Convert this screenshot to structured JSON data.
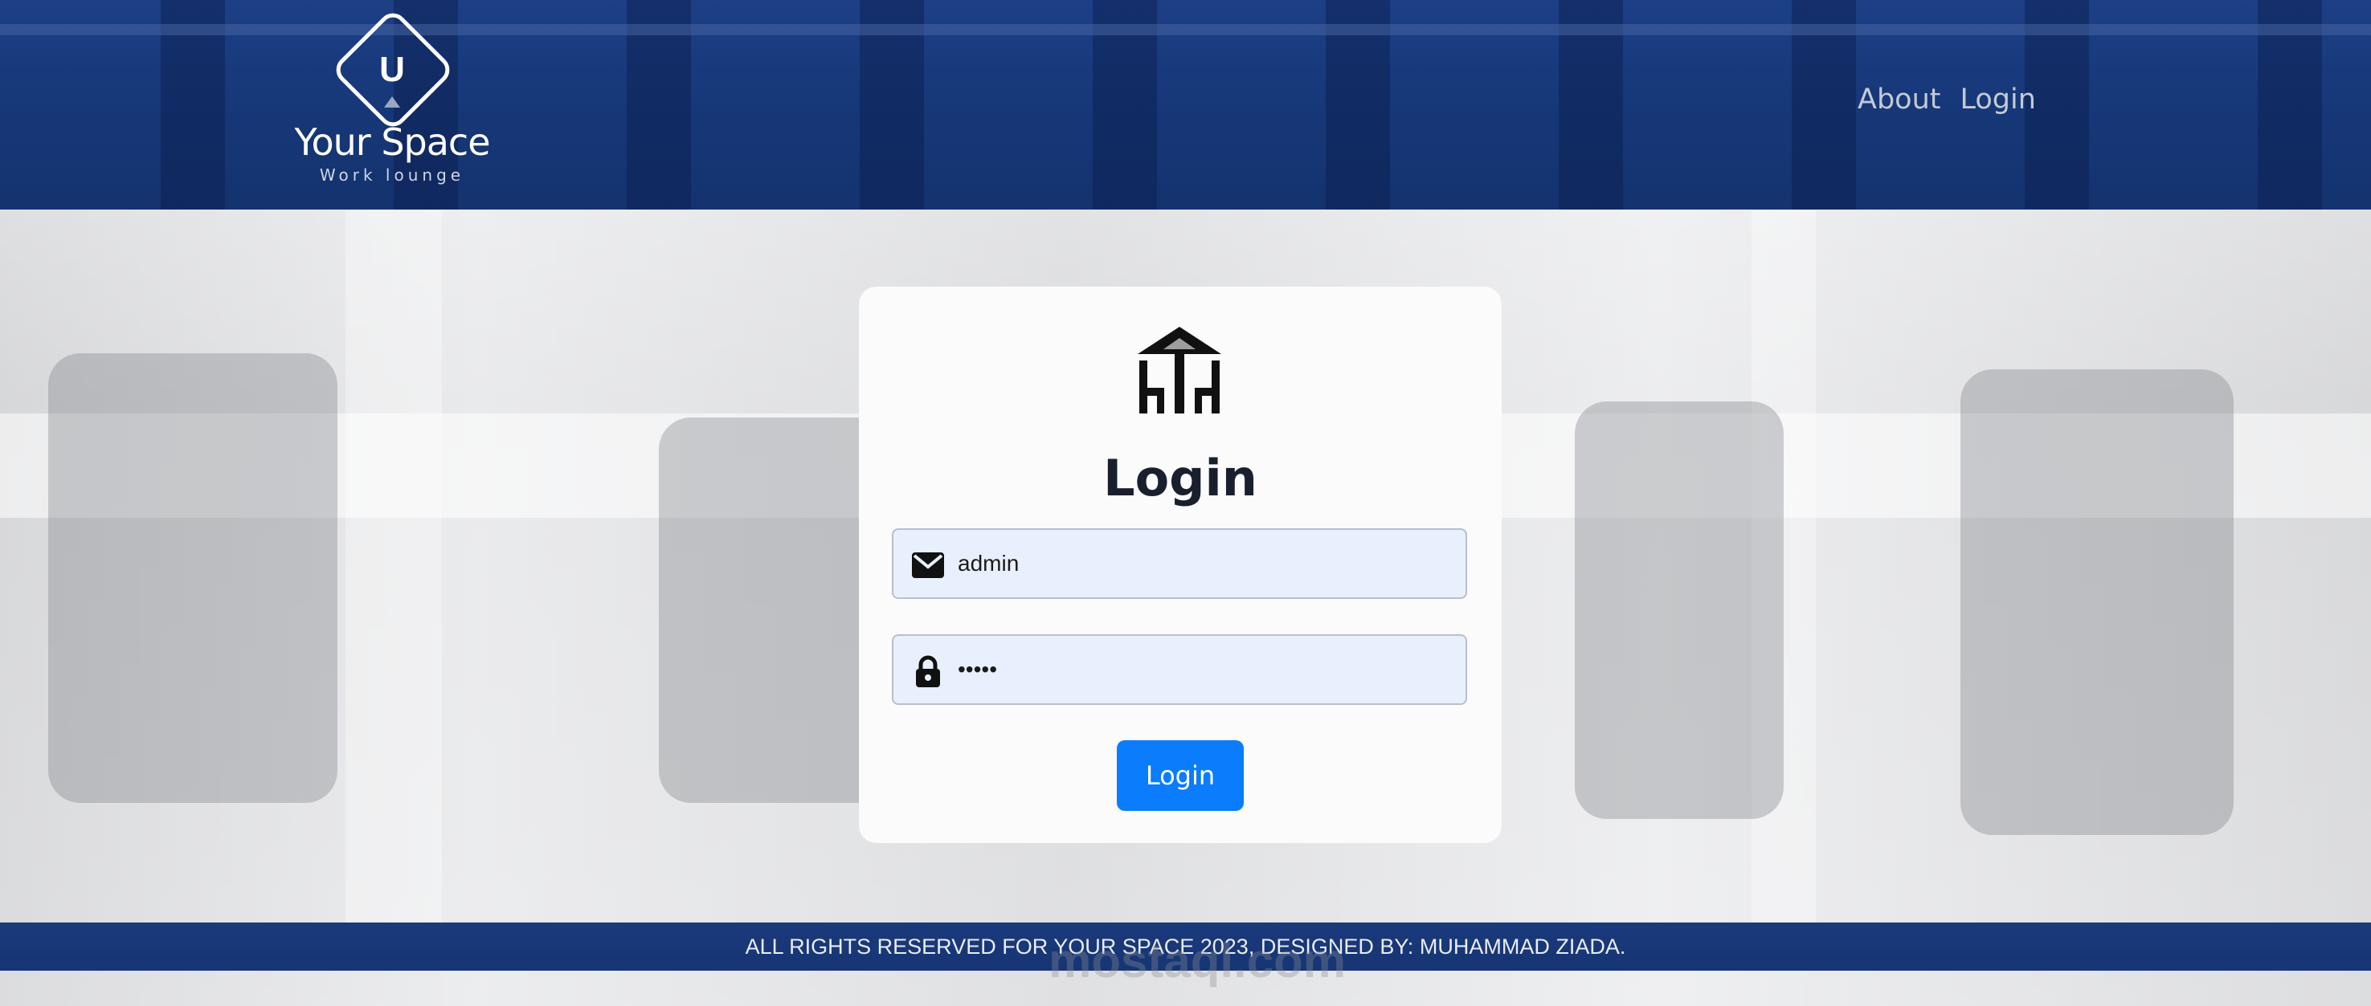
{
  "brand": {
    "logo_letter": "U",
    "name": "Your Space",
    "tagline": "Work lounge"
  },
  "nav": {
    "items": [
      {
        "label": "About"
      },
      {
        "label": "Login"
      }
    ]
  },
  "login_card": {
    "title": "Login",
    "username": {
      "value": "admin",
      "icon": "envelope-icon"
    },
    "password": {
      "value": "•••••",
      "icon": "lock-icon"
    },
    "submit_label": "Login"
  },
  "footer": {
    "text": "ALL RIGHTS RESERVED FOR YOUR SPACE 2023, DESIGNED BY: MUHAMMAD ZIADA."
  },
  "watermark": {
    "text": "mostaql.com"
  },
  "colors": {
    "header_blue": "#1c3f86",
    "button_blue": "#0a7cfc",
    "field_bg": "#e8f0fe"
  }
}
